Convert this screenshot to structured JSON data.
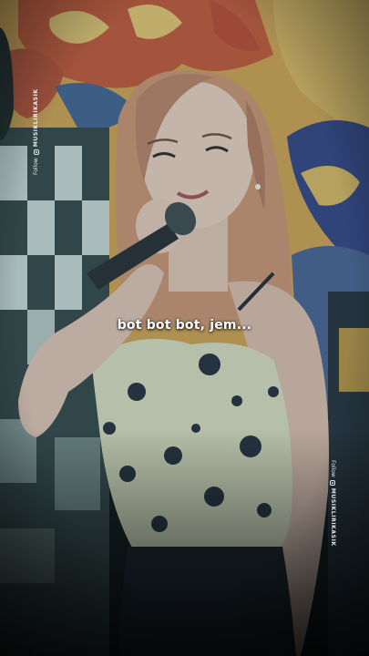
{
  "caption": "bot bot bot, jem...",
  "watermark_left": {
    "follow": "Follow",
    "handle": "MUSIKLIRIKASIK",
    "icon": "instagram-icon"
  },
  "watermark_right": {
    "follow": "Follow",
    "handle": "MUSIKLIRIKASIK",
    "icon": "instagram-icon"
  },
  "colors": {
    "background_mural": "#d8a64a",
    "dress": "#d9d8b8",
    "hair": "#c98d6a",
    "skin": "#e7c6b5",
    "caption_text": "#ffffff"
  }
}
